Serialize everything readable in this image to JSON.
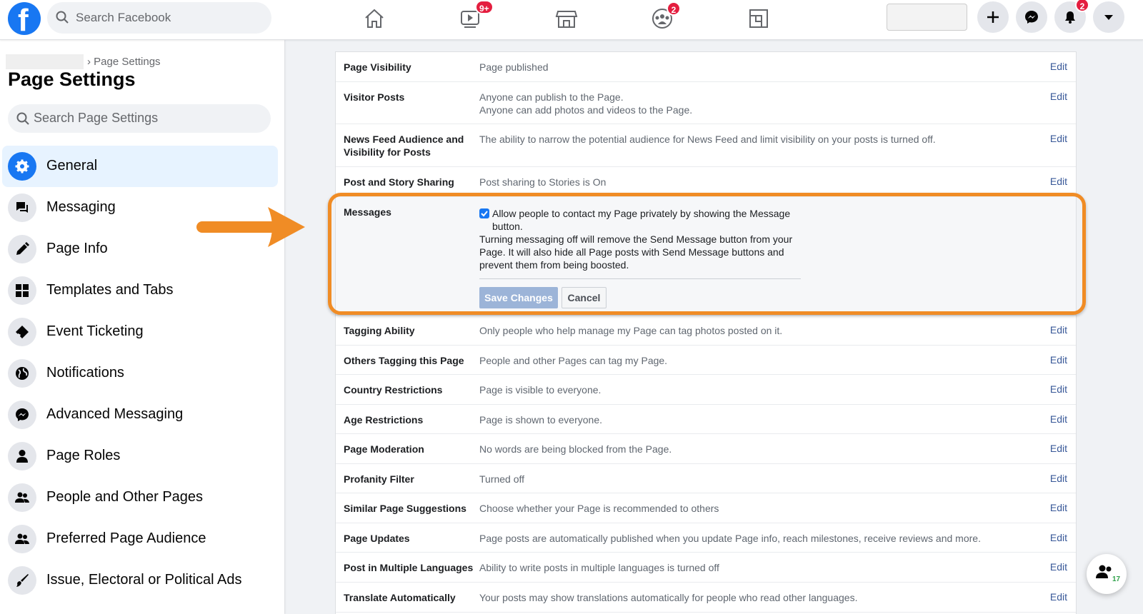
{
  "topbar": {
    "search_placeholder": "Search Facebook",
    "logo_letter": "f",
    "nav_icons": [
      {
        "icon": "home-icon",
        "badge": ""
      },
      {
        "icon": "watch-icon",
        "badge": "9+"
      },
      {
        "icon": "marketplace-icon",
        "badge": ""
      },
      {
        "icon": "groups-icon",
        "badge": "2"
      },
      {
        "icon": "gaming-icon",
        "badge": ""
      }
    ],
    "notification_badge": "2",
    "brand_color": "#1877f2",
    "badge_color": "#e41e3f"
  },
  "sidebar": {
    "breadcrumb": "› Page Settings",
    "title": "Page Settings",
    "search_placeholder": "Search Page Settings",
    "items": [
      {
        "label": "General",
        "icon": "gear-icon",
        "active": true
      },
      {
        "label": "Messaging",
        "icon": "messaging-icon"
      },
      {
        "label": "Page Info",
        "icon": "pencil-icon"
      },
      {
        "label": "Templates and Tabs",
        "icon": "grid-icon"
      },
      {
        "label": "Event Ticketing",
        "icon": "ticket-icon"
      },
      {
        "label": "Notifications",
        "icon": "globe-icon"
      },
      {
        "label": "Advanced Messaging",
        "icon": "messenger-icon"
      },
      {
        "label": "Page Roles",
        "icon": "person-icon"
      },
      {
        "label": "People and Other Pages",
        "icon": "people-icon"
      },
      {
        "label": "Preferred Page Audience",
        "icon": "people-icon"
      },
      {
        "label": "Issue, Electoral or Political Ads",
        "icon": "brush-icon"
      }
    ]
  },
  "settings": {
    "edit_label": "Edit",
    "rows": [
      {
        "name": "Page Visibility",
        "desc": "Page published"
      },
      {
        "name": "Visitor Posts",
        "desc": "Anyone can publish to the Page.\nAnyone can add photos and videos to the Page."
      },
      {
        "name": "News Feed Audience and Visibility for Posts",
        "desc": "The ability to narrow the potential audience for News Feed and limit visibility on your posts is turned off."
      },
      {
        "name": "Post and Story Sharing",
        "desc": "Post sharing to Stories is On"
      },
      {
        "name": "Tagging Ability",
        "desc": "Only people who help manage my Page can tag photos posted on it."
      },
      {
        "name": "Others Tagging this Page",
        "desc": "People and other Pages can tag my Page."
      },
      {
        "name": "Country Restrictions",
        "desc": "Page is visible to everyone."
      },
      {
        "name": "Age Restrictions",
        "desc": "Page is shown to everyone."
      },
      {
        "name": "Page Moderation",
        "desc": "No words are being blocked from the Page."
      },
      {
        "name": "Profanity Filter",
        "desc": "Turned off"
      },
      {
        "name": "Similar Page Suggestions",
        "desc": "Choose whether your Page is recommended to others"
      },
      {
        "name": "Page Updates",
        "desc": "Page posts are automatically published when you update Page info, reach milestones, receive reviews and more."
      },
      {
        "name": "Post in Multiple Languages",
        "desc": "Ability to write posts in multiple languages is turned off"
      },
      {
        "name": "Translate Automatically",
        "desc": "Your posts may show translations automatically for people who read other languages."
      }
    ],
    "messages": {
      "name": "Messages",
      "checkbox_label": "Allow people to contact my Page privately by showing the Message button.",
      "checked": true,
      "note": "Turning messaging off will remove the Send Message button from your Page. It will also hide all Page posts with Send Message buttons and prevent them from being boosted.",
      "save_label": "Save Changes",
      "cancel_label": "Cancel"
    }
  },
  "annotation": {
    "highlight_color": "#f08c25"
  },
  "chat_widget": {
    "count": "17"
  }
}
